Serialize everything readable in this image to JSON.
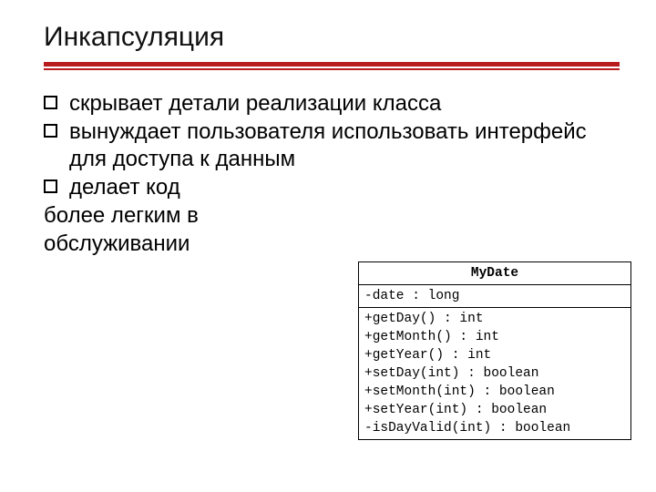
{
  "title": "Инкапсуляция",
  "bullets": [
    "скрывает детали реализации класса",
    "вынуждает пользователя использовать интерфейс для доступа к данным",
    "делает код"
  ],
  "after_lines": [
    "более легким в",
    "обслуживании"
  ],
  "uml": {
    "class_name": "MyDate",
    "attributes": [
      "-date : long"
    ],
    "operations": [
      "+getDay() : int",
      "+getMonth() : int",
      "+getYear() : int",
      "+setDay(int) : boolean",
      "+setMonth(int) : boolean",
      "+setYear(int) : boolean",
      "-isDayValid(int) : boolean"
    ]
  }
}
